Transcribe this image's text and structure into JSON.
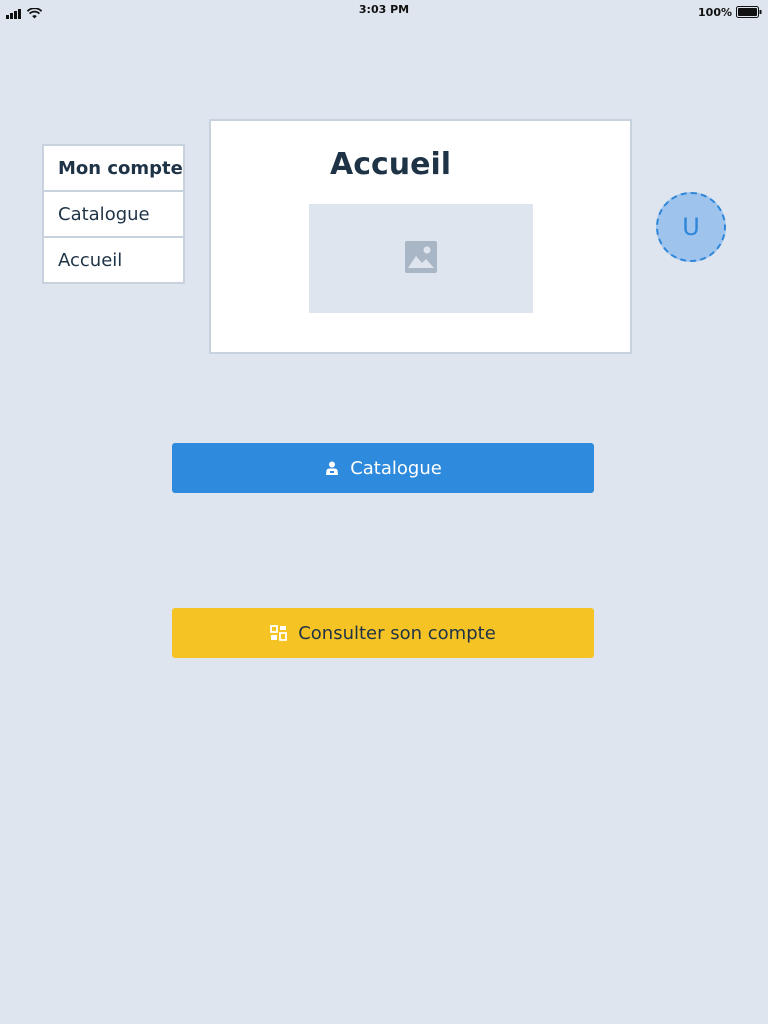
{
  "status_bar": {
    "time": "3:03 PM",
    "battery": "100%",
    "icons": [
      "signal-icon",
      "wifi-icon",
      "battery-icon"
    ]
  },
  "menu": {
    "items": [
      {
        "label": "Mon compte",
        "active": true
      },
      {
        "label": "Catalogue",
        "active": false
      },
      {
        "label": "Accueil",
        "active": false
      }
    ]
  },
  "card": {
    "title": "Accueil",
    "image_icon": "image-icon"
  },
  "avatar": {
    "initial": "U"
  },
  "buttons": {
    "catalogue": {
      "label": "Catalogue",
      "icon": "user-icon"
    },
    "compte": {
      "label": "Consulter son compte",
      "icon": "account-icon"
    }
  },
  "colors": {
    "background": "#dfe5ee",
    "primary": "#2e8add",
    "warning": "#f6c325",
    "text": "#1f3347",
    "border": "#c8d2df",
    "avatar_fill": "#9ec4ee"
  }
}
